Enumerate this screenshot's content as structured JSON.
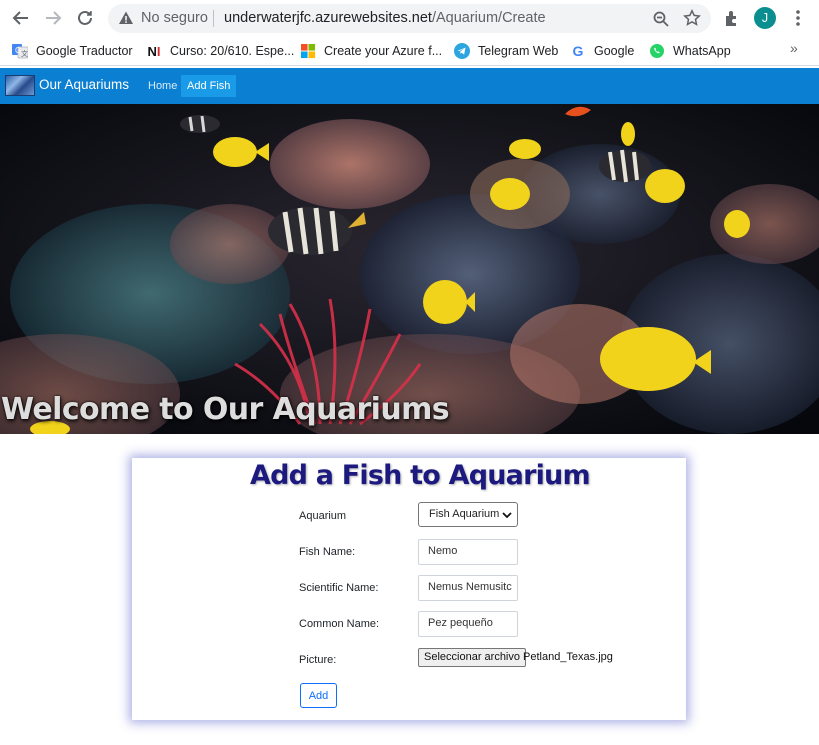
{
  "browser": {
    "security_label": "No seguro",
    "url_host": "underwaterjfc.azurewebsites.net",
    "url_path": "/Aquarium/Create",
    "profile_initial": "J",
    "bookmarks": [
      {
        "label": "Google Traductor",
        "icon": "google-translate-icon"
      },
      {
        "label": "Curso: 20/610. Espe...",
        "icon": "ni-icon"
      },
      {
        "label": "Create your Azure f...",
        "icon": "microsoft-icon"
      },
      {
        "label": "Telegram Web",
        "icon": "telegram-icon"
      },
      {
        "label": "Google",
        "icon": "google-icon"
      },
      {
        "label": "WhatsApp",
        "icon": "whatsapp-icon"
      }
    ],
    "bookmarks_more": "»"
  },
  "site": {
    "brand": "Our Aquariums",
    "nav": [
      {
        "label": "Home",
        "active": false
      },
      {
        "label": "Add Fish",
        "active": true
      }
    ],
    "nav_color": "#0b7fd1",
    "hero_title": "Welcome to Our Aquariums"
  },
  "form": {
    "title": "Add a Fish to Aquarium",
    "title_color": "#1c1a7e",
    "fields": {
      "aquarium": {
        "label": "Aquarium",
        "value": "Fish Aquarium"
      },
      "fish_name": {
        "label": "Fish Name:",
        "value": "Nemo"
      },
      "scientific_name": {
        "label": "Scientific Name:",
        "value": "Nemus Nemusitc"
      },
      "common_name": {
        "label": "Common Name:",
        "value": "Pez pequeño"
      },
      "picture": {
        "label": "Picture:",
        "button": "Seleccionar archivo",
        "file": "Petland_Texas.jpg"
      }
    },
    "submit_label": "Add"
  }
}
